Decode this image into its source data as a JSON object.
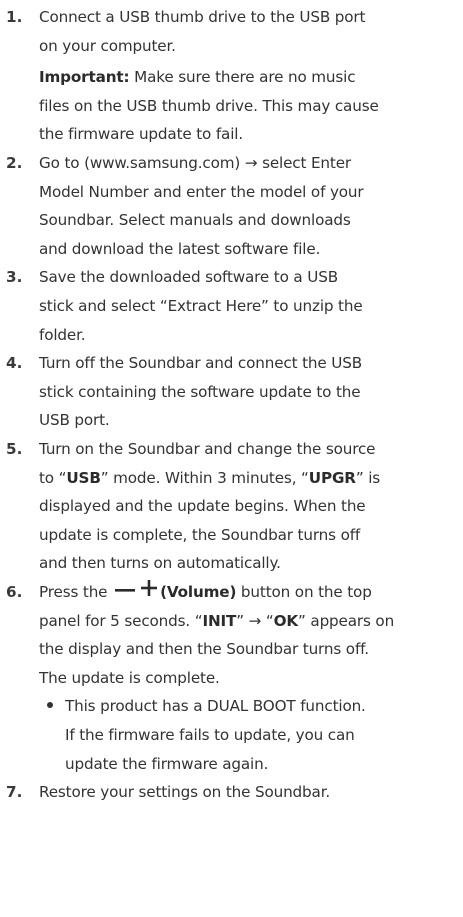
{
  "steps": [
    {
      "number": "1.",
      "lines": [
        "Connect a USB thumb drive to the USB port",
        "on your computer."
      ],
      "note": {
        "label": "Important:",
        "line1": " Make sure there are no music",
        "lines": [
          "files on the USB thumb drive. This may cause",
          "the firmware update to fail."
        ]
      }
    },
    {
      "number": "2.",
      "lines": [
        "Go to (www.samsung.com) → select Enter",
        "Model Number and enter the model of your",
        "Soundbar. Select manuals and downloads",
        "and download the latest software file."
      ]
    },
    {
      "number": "3.",
      "lines": [
        "Save the downloaded software to a USB",
        "stick and select “Extract Here” to unzip the",
        "folder."
      ]
    },
    {
      "number": "4.",
      "lines": [
        "Turn off the Soundbar and connect the USB",
        "stick containing the software update to the",
        "USB port."
      ]
    },
    {
      "number": "5.",
      "line1_a": "Turn on the Soundbar and change the source",
      "line2_a": "to “",
      "line2_b": "USB",
      "line2_c": "” mode. Within 3 minutes, “",
      "line2_d": "UPGR",
      "line2_e": "” is",
      "lines": [
        "displayed and the update begins. When the",
        "update is complete, the Soundbar turns off",
        "and then turns on automatically."
      ]
    },
    {
      "number": "6.",
      "line1_a": "Press the ",
      "line1_b": "(Volume)",
      "line1_c": " button on the top",
      "line2_a": "panel for 5 seconds. “",
      "line2_b": "INIT",
      "line2_c": "” → “",
      "line2_d": "OK",
      "line2_e": "” appears on",
      "lines": [
        "the display and then the Soundbar turns off.",
        "The update is complete."
      ],
      "bullet_lines": [
        "This product has a DUAL BOOT function.",
        "If the firmware fails to update, you can",
        "update the firmware again."
      ]
    },
    {
      "number": "7.",
      "lines": [
        "Restore your settings on the Soundbar."
      ]
    }
  ],
  "icons": [
    "minus-icon",
    "plus-icon"
  ],
  "colors": {
    "text": "#333333",
    "bold": "#2b2b2b"
  }
}
